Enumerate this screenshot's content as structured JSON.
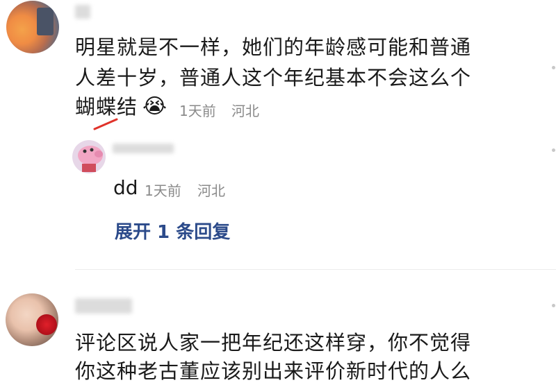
{
  "comments": [
    {
      "lines": [
        "明星就是不一样，她们的年龄感可能和普通",
        "人差十岁，普通人这个年纪基本不会这么个",
        "蝴蝶结"
      ],
      "emoji": "😭",
      "time": "1天前",
      "location": "河北",
      "reply": {
        "text": "dd",
        "time": "1天前",
        "location": "河北"
      },
      "expand_label": "展开 1 条回复"
    },
    {
      "lines": [
        "评论区说人家一把年纪还这样穿，你不觉得",
        "你这种老古董应该别出来评价新时代的人么"
      ]
    }
  ],
  "colors": {
    "text": "#1a1a1a",
    "meta": "#8a8a8a",
    "link": "#2b4a8a",
    "annotation_arrow": "#e0322a"
  }
}
